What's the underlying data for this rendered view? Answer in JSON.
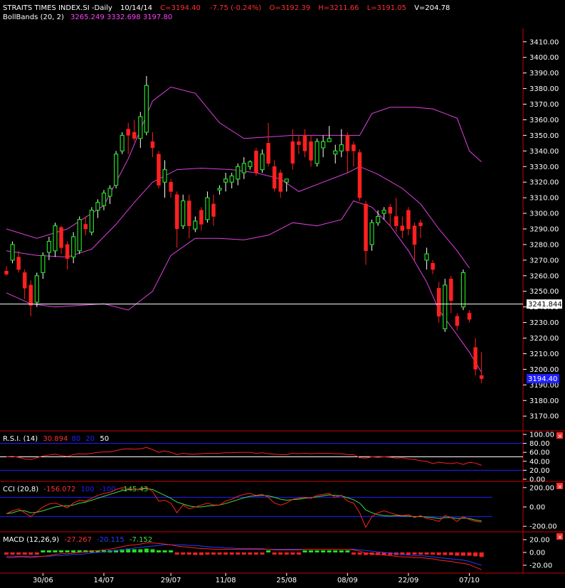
{
  "header": {
    "title": "STRAITS TIMES INDEX.SI -Daily",
    "date": "10/14/14",
    "close": "C=3194.40",
    "change": "-7.75 (-0.24%)",
    "open": "O=3192.39",
    "high": "H=3211.66",
    "low": "L=3191.05",
    "volume": "V=204.78"
  },
  "bollinger_legend": {
    "label": "BollBands (20, 2)",
    "values": "3265.249 3332.698 3197.80"
  },
  "price_tags": {
    "crosshair": "3241.844",
    "last": "3194.40"
  },
  "rsi_panel": {
    "label": "R.S.I. (14)",
    "value": "30.894",
    "upper": "80",
    "lower": "20",
    "mid": "50",
    "ticks": [
      "100.00",
      "80.00",
      "60.00",
      "40.00",
      "20.00",
      "0.00"
    ]
  },
  "cci_panel": {
    "label": "CCI (20,8)",
    "value": "-156.072",
    "upper": "100",
    "lower": "-100",
    "signal": "-145.43",
    "ticks": [
      "200.00",
      "0.00",
      "-200.00"
    ]
  },
  "macd_panel": {
    "label": "MACD (12,26,9)",
    "macd": "-27.267",
    "signal": "-20.115",
    "hist": "-7.152",
    "ticks": [
      "20.00",
      "0.00",
      "-20.00"
    ]
  },
  "colors": {
    "up": "#22dd22",
    "down": "#ff2020",
    "bands": "#e040e0",
    "levels": "#2020ff",
    "grid_line": "#ffffff",
    "axis": "#cc0000",
    "text_red": "#ff3030",
    "text_magenta": "#ff40ff",
    "tag_blue": "#2020ff",
    "macd_line": "#2040ff",
    "cci_signal": "#40dd40"
  },
  "chart_data": {
    "type": "candlestick",
    "price_axis": {
      "ticks": [
        "3410.00",
        "3400.00",
        "3390.00",
        "3380.00",
        "3370.00",
        "3360.00",
        "3350.00",
        "3340.00",
        "3330.00",
        "3320.00",
        "3310.00",
        "3300.00",
        "3290.00",
        "3280.00",
        "3270.00",
        "3260.00",
        "3250.00",
        "3240.00",
        "3230.00",
        "3220.00",
        "3210.00",
        "3200.00",
        "3190.00",
        "3180.00",
        "3170.00"
      ],
      "ylim": [
        3166,
        3414
      ]
    },
    "date_ticks": [
      {
        "label": "30/06",
        "index": 6
      },
      {
        "label": "14/07",
        "index": 16
      },
      {
        "label": "29/07",
        "index": 27
      },
      {
        "label": "11/08",
        "index": 36
      },
      {
        "label": "25/08",
        "index": 46
      },
      {
        "label": "08/09",
        "index": 56
      },
      {
        "label": "22/09",
        "index": 66
      },
      {
        "label": "07/10",
        "index": 76
      }
    ],
    "crosshair_price": 3241.844,
    "ohlc": [
      [
        3263,
        3266,
        3260,
        3261
      ],
      [
        3270,
        3282,
        3268,
        3280
      ],
      [
        3272,
        3276,
        3262,
        3264
      ],
      [
        3262,
        3264,
        3245,
        3252
      ],
      [
        3254,
        3257,
        3234,
        3241
      ],
      [
        3243,
        3262,
        3240,
        3260
      ],
      [
        3262,
        3275,
        3258,
        3273
      ],
      [
        3275,
        3285,
        3270,
        3282
      ],
      [
        3276,
        3294,
        3272,
        3292
      ],
      [
        3291,
        3292,
        3274,
        3278
      ],
      [
        3280,
        3282,
        3264,
        3271
      ],
      [
        3272,
        3288,
        3268,
        3285
      ],
      [
        3276,
        3298,
        3274,
        3296
      ],
      [
        3293,
        3298,
        3286,
        3290
      ],
      [
        3288,
        3304,
        3286,
        3302
      ],
      [
        3302,
        3309,
        3297,
        3307
      ],
      [
        3305,
        3315,
        3302,
        3313
      ],
      [
        3311,
        3318,
        3306,
        3316
      ],
      [
        3318,
        3340,
        3316,
        3338
      ],
      [
        3340,
        3352,
        3338,
        3350
      ],
      [
        3354,
        3358,
        3338,
        3350
      ],
      [
        3352,
        3360,
        3346,
        3348
      ],
      [
        3348,
        3365,
        3342,
        3362
      ],
      [
        3352,
        3388,
        3350,
        3382
      ],
      [
        3346,
        3352,
        3336,
        3342
      ],
      [
        3338,
        3340,
        3316,
        3318
      ],
      [
        3320,
        3334,
        3310,
        3328
      ],
      [
        3320,
        3322,
        3310,
        3314
      ],
      [
        3312,
        3314,
        3278,
        3290
      ],
      [
        3292,
        3312,
        3290,
        3308
      ],
      [
        3308,
        3312,
        3284,
        3292
      ],
      [
        3290,
        3298,
        3288,
        3295
      ],
      [
        3302,
        3304,
        3289,
        3293
      ],
      [
        3296,
        3314,
        3294,
        3310
      ],
      [
        3306,
        3312,
        3292,
        3298
      ],
      [
        3315,
        3318,
        3312,
        3316
      ],
      [
        3320,
        3326,
        3314,
        3322
      ],
      [
        3320,
        3326,
        3316,
        3324
      ],
      [
        3322,
        3332,
        3318,
        3330
      ],
      [
        3326,
        3336,
        3322,
        3332
      ],
      [
        3330,
        3334,
        3328,
        3333
      ],
      [
        3340,
        3342,
        3324,
        3326
      ],
      [
        3328,
        3341,
        3326,
        3338
      ],
      [
        3345,
        3358,
        3330,
        3332
      ],
      [
        3330,
        3334,
        3314,
        3316
      ],
      [
        3326,
        3328,
        3310,
        3314
      ],
      [
        3320,
        3322,
        3314,
        3322
      ],
      [
        3346,
        3354,
        3328,
        3332
      ],
      [
        3346,
        3350,
        3338,
        3344
      ],
      [
        3350,
        3354,
        3336,
        3340
      ],
      [
        3346,
        3350,
        3330,
        3334
      ],
      [
        3332,
        3348,
        3330,
        3346
      ],
      [
        3342,
        3350,
        3336,
        3346
      ],
      [
        3346,
        3356,
        3346,
        3348
      ],
      [
        3338,
        3344,
        3332,
        3340
      ],
      [
        3340,
        3354,
        3336,
        3344
      ],
      [
        3350,
        3352,
        3326,
        3340
      ],
      [
        3344,
        3346,
        3330,
        3340
      ],
      [
        3339,
        3341,
        3308,
        3310
      ],
      [
        3306,
        3308,
        3267,
        3276
      ],
      [
        3280,
        3296,
        3276,
        3294
      ],
      [
        3294,
        3302,
        3292,
        3298
      ],
      [
        3300,
        3304,
        3296,
        3302
      ],
      [
        3304,
        3306,
        3292,
        3300
      ],
      [
        3298,
        3310,
        3288,
        3292
      ],
      [
        3292,
        3298,
        3284,
        3289
      ],
      [
        3302,
        3304,
        3286,
        3290
      ],
      [
        3292,
        3294,
        3270,
        3280
      ],
      [
        3294,
        3296,
        3284,
        3292
      ],
      [
        3270,
        3278,
        3264,
        3274
      ],
      [
        3268,
        3270,
        3261,
        3264
      ],
      [
        3252,
        3256,
        3230,
        3234
      ],
      [
        3226,
        3258,
        3224,
        3254
      ],
      [
        3258,
        3260,
        3236,
        3244
      ],
      [
        3234,
        3236,
        3225,
        3228
      ],
      [
        3240,
        3264,
        3238,
        3262
      ],
      [
        3236,
        3238,
        3230,
        3232
      ],
      [
        3214,
        3220,
        3196,
        3200
      ],
      [
        3196,
        3211,
        3191,
        3194
      ]
    ],
    "bollinger": {
      "upper": [
        [
          0,
          3290
        ],
        [
          5,
          3284
        ],
        [
          10,
          3290
        ],
        [
          16,
          3305
        ],
        [
          20,
          3335
        ],
        [
          24,
          3372
        ],
        [
          27,
          3381
        ],
        [
          31,
          3377
        ],
        [
          35,
          3358
        ],
        [
          39,
          3348
        ],
        [
          43,
          3349
        ],
        [
          47,
          3350
        ],
        [
          51,
          3350
        ],
        [
          55,
          3350
        ],
        [
          58,
          3350
        ],
        [
          60,
          3364
        ],
        [
          63,
          3368
        ],
        [
          67,
          3368
        ],
        [
          70,
          3367
        ],
        [
          72,
          3364
        ],
        [
          74,
          3361
        ],
        [
          76,
          3340
        ],
        [
          78,
          3333
        ]
      ],
      "middle": [
        [
          0,
          3276
        ],
        [
          5,
          3273
        ],
        [
          10,
          3272
        ],
        [
          14,
          3277
        ],
        [
          18,
          3293
        ],
        [
          21,
          3307
        ],
        [
          24,
          3320
        ],
        [
          28,
          3328
        ],
        [
          32,
          3329
        ],
        [
          37,
          3328
        ],
        [
          41,
          3326
        ],
        [
          45,
          3322
        ],
        [
          48,
          3314
        ],
        [
          52,
          3320
        ],
        [
          56,
          3326
        ],
        [
          58,
          3330
        ],
        [
          61,
          3325
        ],
        [
          65,
          3316
        ],
        [
          68,
          3306
        ],
        [
          71,
          3290
        ],
        [
          74,
          3276
        ],
        [
          76,
          3265
        ]
      ],
      "lower": [
        [
          0,
          3249
        ],
        [
          4,
          3242
        ],
        [
          8,
          3240
        ],
        [
          12,
          3241
        ],
        [
          16,
          3242
        ],
        [
          20,
          3238
        ],
        [
          24,
          3250
        ],
        [
          27,
          3273
        ],
        [
          31,
          3284
        ],
        [
          35,
          3284
        ],
        [
          39,
          3283
        ],
        [
          43,
          3286
        ],
        [
          47,
          3294
        ],
        [
          51,
          3292
        ],
        [
          55,
          3296
        ],
        [
          57,
          3308
        ],
        [
          60,
          3304
        ],
        [
          63,
          3292
        ],
        [
          66,
          3276
        ],
        [
          69,
          3256
        ],
        [
          71,
          3238
        ],
        [
          74,
          3222
        ],
        [
          76,
          3211
        ],
        [
          78,
          3198
        ]
      ]
    },
    "rsi": {
      "range": [
        0,
        100
      ],
      "levels": [
        80,
        50,
        20
      ],
      "values": [
        50,
        51,
        49,
        45,
        44,
        48,
        52,
        54,
        56,
        53,
        51,
        55,
        57,
        56,
        58,
        60,
        61,
        61,
        64,
        67,
        68,
        67,
        68,
        71,
        66,
        60,
        63,
        60,
        55,
        58,
        56,
        56,
        57,
        58,
        58,
        58,
        59,
        59,
        60,
        60,
        60,
        58,
        59,
        57,
        56,
        55,
        55,
        58,
        57,
        58,
        57,
        58,
        58,
        58,
        57,
        57,
        55,
        55,
        48,
        47,
        50,
        49,
        50,
        49,
        47,
        48,
        45,
        44,
        41,
        40,
        35,
        38,
        36,
        35,
        37,
        33,
        38,
        36,
        31
      ]
    },
    "cci": {
      "range": [
        -250,
        250
      ],
      "levels": [
        100,
        -100
      ],
      "values": [
        -70,
        -40,
        -20,
        -60,
        -100,
        -50,
        0,
        30,
        40,
        20,
        -10,
        40,
        70,
        60,
        90,
        120,
        140,
        150,
        180,
        200,
        190,
        180,
        190,
        200,
        160,
        60,
        70,
        40,
        -60,
        20,
        -20,
        0,
        20,
        40,
        20,
        20,
        60,
        80,
        110,
        130,
        140,
        120,
        130,
        100,
        40,
        20,
        40,
        80,
        90,
        100,
        90,
        120,
        130,
        140,
        100,
        120,
        60,
        40,
        -60,
        -210,
        -100,
        -60,
        -40,
        -60,
        -80,
        -90,
        -80,
        -110,
        -90,
        -120,
        -130,
        -150,
        -90,
        -110,
        -150,
        -100,
        -130,
        -150,
        -156
      ],
      "signal": [
        -70,
        -60,
        -40,
        -40,
        -60,
        -55,
        -40,
        -20,
        0,
        10,
        10,
        20,
        40,
        50,
        70,
        90,
        110,
        130,
        150,
        170,
        180,
        180,
        185,
        190,
        180,
        150,
        120,
        90,
        50,
        30,
        10,
        0,
        0,
        10,
        15,
        20,
        35,
        55,
        75,
        95,
        110,
        115,
        120,
        115,
        100,
        80,
        70,
        75,
        80,
        90,
        95,
        105,
        115,
        125,
        120,
        115,
        95,
        75,
        40,
        -30,
        -60,
        -80,
        -90,
        -95,
        -90,
        -95,
        -95,
        -100,
        -100,
        -105,
        -110,
        -120,
        -110,
        -110,
        -120,
        -115,
        -120,
        -135,
        -145
      ]
    },
    "macd": {
      "range": [
        -30,
        30
      ],
      "macd": [
        -8,
        -8,
        -7,
        -7,
        -8,
        -7,
        -6,
        -5,
        -3,
        -2,
        -2,
        -1,
        0,
        1,
        2,
        3,
        4,
        5,
        7,
        9,
        11,
        12,
        13,
        15,
        15,
        14,
        13,
        12,
        10,
        9,
        8,
        7,
        6,
        6,
        5,
        5,
        5,
        5,
        5,
        5,
        5,
        5,
        5,
        5,
        4,
        4,
        4,
        4,
        4,
        5,
        5,
        5,
        5,
        5,
        5,
        5,
        5,
        4,
        2,
        -1,
        -2,
        -3,
        -4,
        -5,
        -6,
        -7,
        -7,
        -8,
        -8,
        -9,
        -10,
        -12,
        -13,
        -14,
        -16,
        -17,
        -19,
        -23,
        -27
      ],
      "signal": [
        -6,
        -6,
        -6,
        -6,
        -6,
        -6,
        -6,
        -6,
        -5,
        -5,
        -4,
        -3,
        -3,
        -2,
        -1,
        0,
        1,
        2,
        3,
        4,
        5,
        7,
        8,
        9,
        10,
        11,
        12,
        12,
        12,
        12,
        11,
        11,
        10,
        9,
        8,
        8,
        7,
        7,
        6,
        6,
        6,
        6,
        6,
        5,
        5,
        5,
        5,
        5,
        5,
        5,
        5,
        5,
        5,
        5,
        5,
        5,
        5,
        5,
        4,
        3,
        2,
        1,
        0,
        -1,
        -2,
        -3,
        -4,
        -5,
        -5,
        -6,
        -7,
        -8,
        -9,
        -10,
        -11,
        -12,
        -14,
        -17,
        -20
      ]
    }
  }
}
